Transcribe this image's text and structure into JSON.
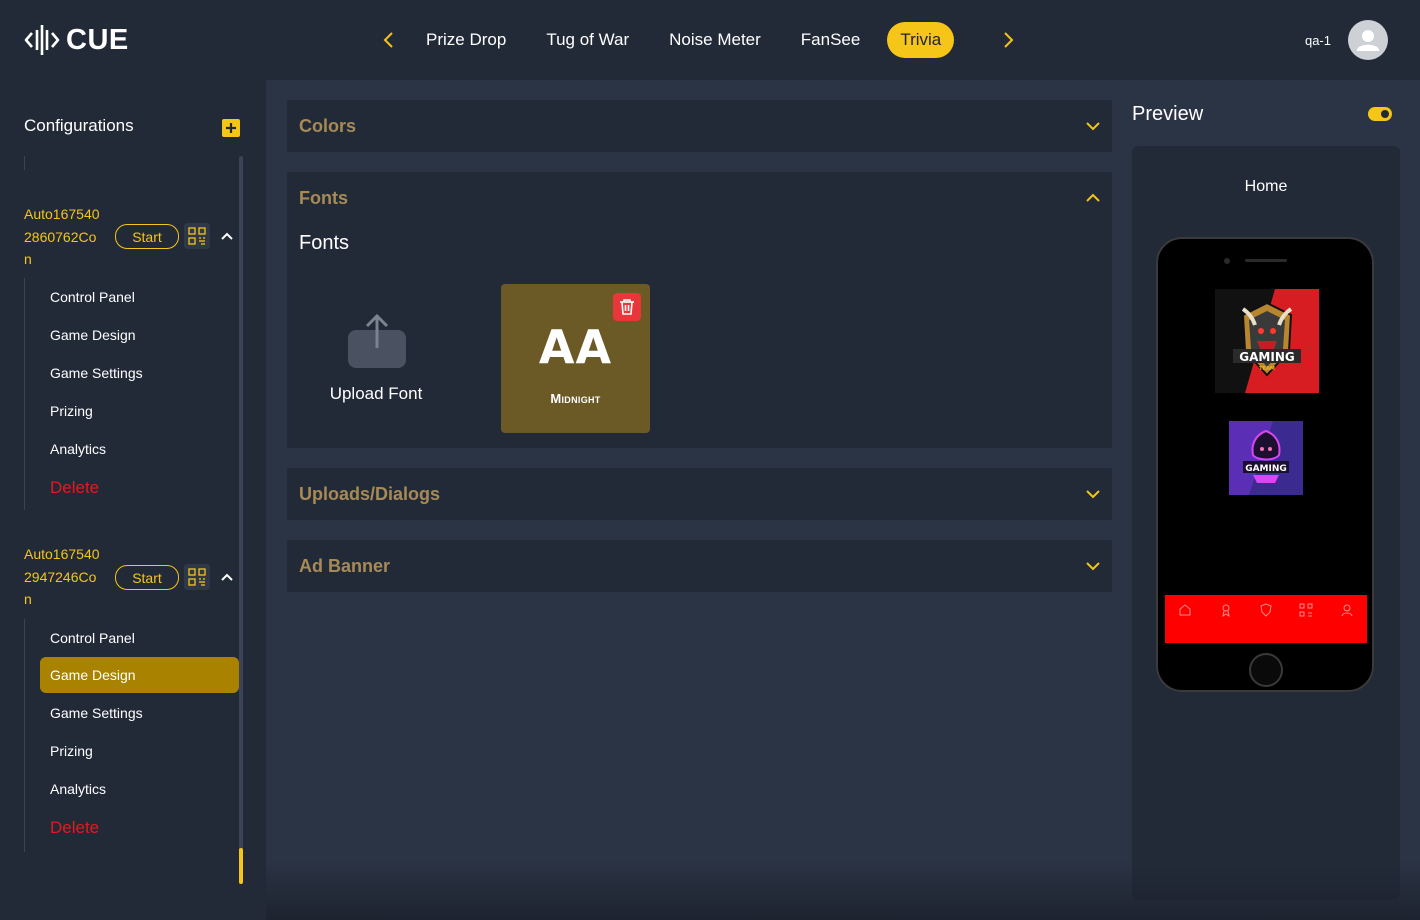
{
  "app": {
    "logo_text": "CUE"
  },
  "nav": {
    "tabs": [
      {
        "label": "Prize Drop",
        "active": false
      },
      {
        "label": "Tug of War",
        "active": false
      },
      {
        "label": "Noise Meter",
        "active": false
      },
      {
        "label": "FanSee",
        "active": false
      },
      {
        "label": "Trivia",
        "active": true
      }
    ]
  },
  "user": {
    "name": "qa-1"
  },
  "sidebar": {
    "title": "Configurations",
    "configs": [
      {
        "name_lines": [
          "Auto167540",
          "2860762Co",
          "n"
        ],
        "start_label": "Start",
        "expanded": true,
        "menu": [
          "Control Panel",
          "Game Design",
          "Game Settings",
          "Prizing",
          "Analytics"
        ],
        "delete_label": "Delete"
      },
      {
        "name_lines": [
          "Auto167540",
          "2947246Co",
          "n"
        ],
        "start_label": "Start",
        "expanded": true,
        "menu": [
          "Control Panel",
          "Game Design",
          "Game Settings",
          "Prizing",
          "Analytics"
        ],
        "delete_label": "Delete",
        "active_item": "Game Design"
      }
    ]
  },
  "main": {
    "panels": [
      {
        "title": "Colors",
        "expanded": false
      },
      {
        "title": "Fonts",
        "expanded": true
      },
      {
        "title": "Uploads/Dialogs",
        "expanded": false
      },
      {
        "title": "Ad Banner",
        "expanded": false
      }
    ],
    "fonts_section": {
      "heading": "Fonts",
      "upload_label": "Upload Font",
      "font_card": {
        "sample": "AA",
        "name": "Midnight"
      }
    }
  },
  "preview": {
    "title": "Preview",
    "screen_name": "Home",
    "toggle_on": true,
    "logo_texts": [
      "GAMING",
      "TEAM",
      "GAMING"
    ]
  },
  "colors": {
    "accent": "#f5c518",
    "bg_dark": "#222a38",
    "bg_main": "#2b3445",
    "danger": "#e5191b",
    "panel_title": "#a78a55",
    "font_card": "#6b5a26",
    "game_design_active": "#a98300",
    "phone_tabbar": "#ff0000"
  }
}
